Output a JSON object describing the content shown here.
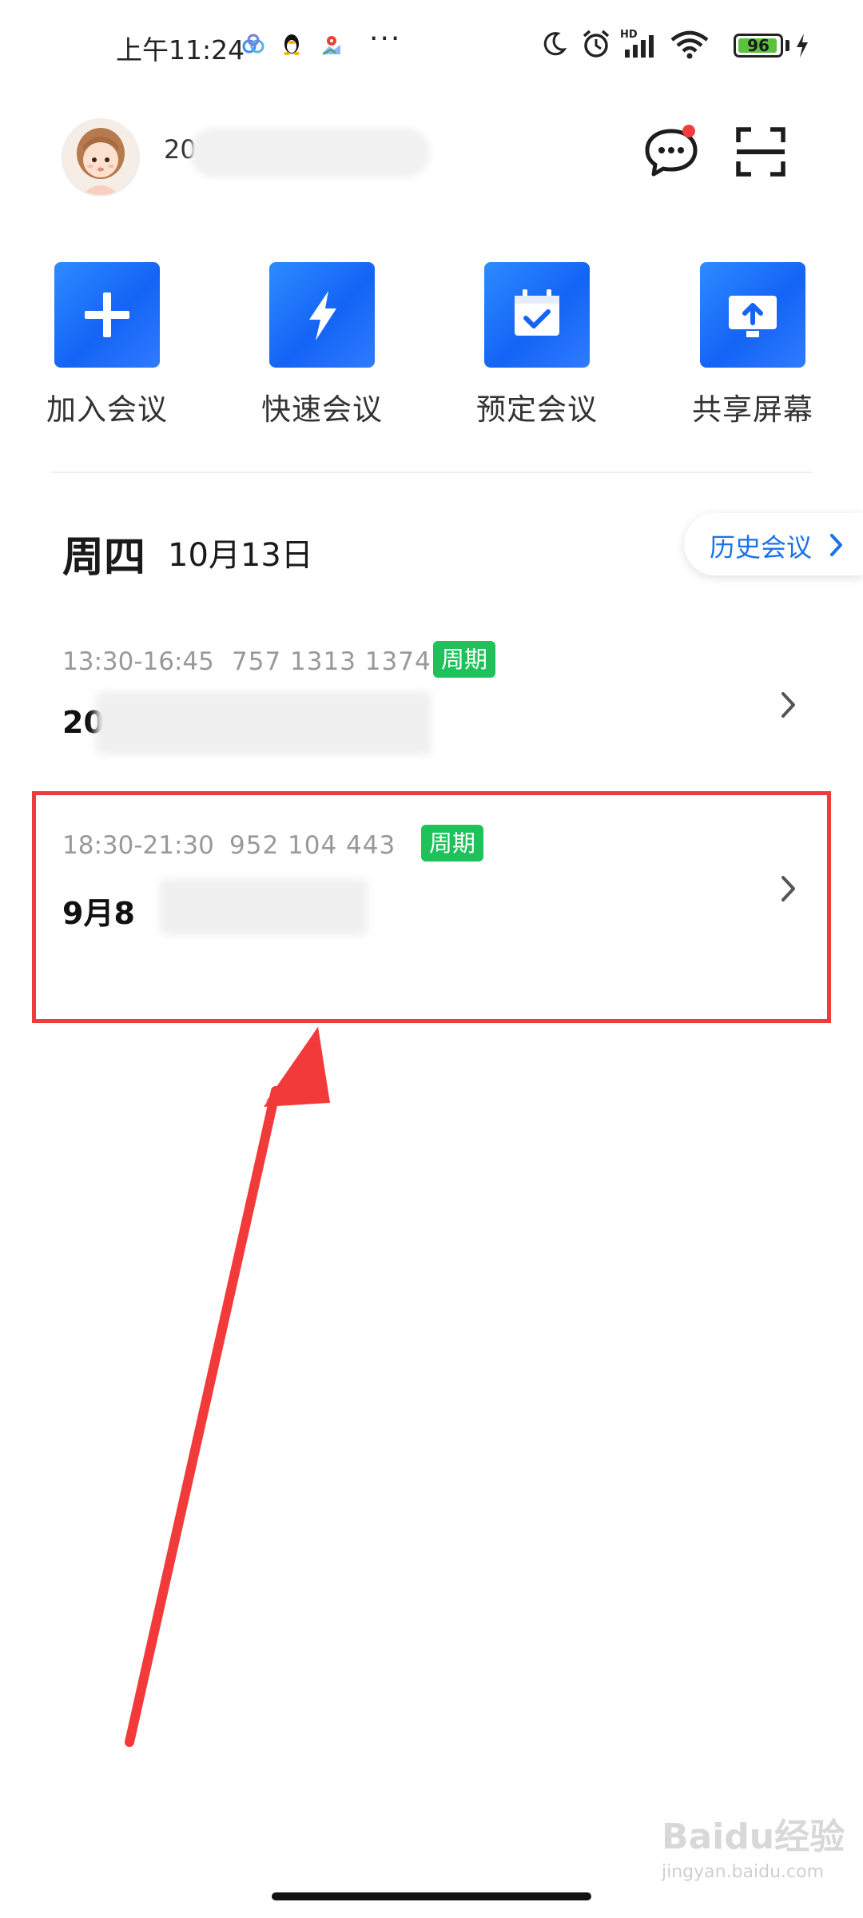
{
  "status_bar": {
    "time": "上午11:24",
    "battery": "96",
    "battery_level": 0.96,
    "network_label": "HD"
  },
  "header": {
    "username": "20"
  },
  "quick_actions": [
    {
      "label": "加入会议",
      "icon": "plus-icon"
    },
    {
      "label": "快速会议",
      "icon": "lightning-icon"
    },
    {
      "label": "预定会议",
      "icon": "calendar-check-icon"
    },
    {
      "label": "共享屏幕",
      "icon": "screen-share-icon"
    }
  ],
  "day": {
    "weekday": "周四",
    "date": "10月13日",
    "history_button": "历史会议"
  },
  "meetings": [
    {
      "time": "13:30-16:45",
      "meeting_id": "757 1313 1374",
      "tag": "周期",
      "title": "202"
    },
    {
      "time": "18:30-21:30",
      "meeting_id": "952 104 443",
      "tag": "周期",
      "title": "9月8"
    }
  ],
  "watermark": {
    "brand": "Baidu经验",
    "url": "jingyan.baidu.com"
  },
  "colors": {
    "accent": "#1a73e8",
    "tile_blue": "#1464f5",
    "tag_green": "#1fc25a",
    "highlight_red": "#ee3b3b"
  }
}
